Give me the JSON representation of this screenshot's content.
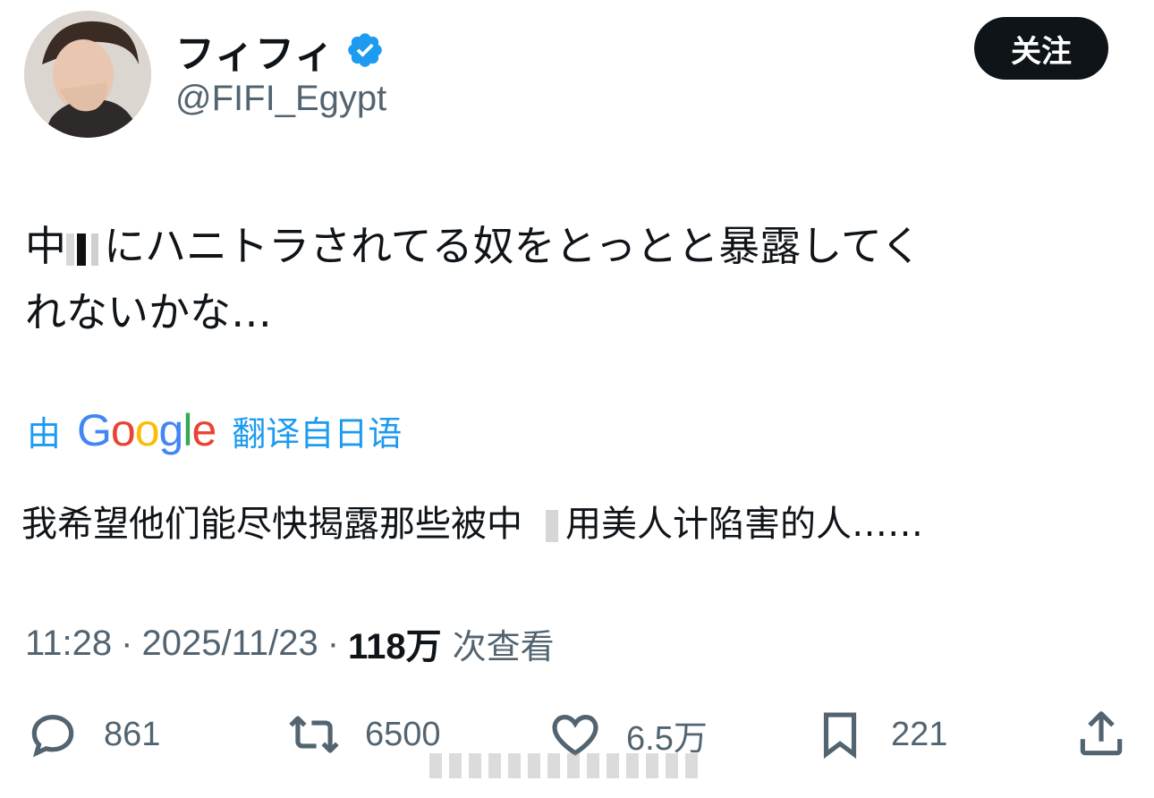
{
  "user": {
    "display_name": "フィフィ",
    "handle": "@FIFI_Egypt",
    "verified": true
  },
  "follow_button": {
    "label": "关注"
  },
  "tweet": {
    "text_part1": "中",
    "text_part2": "にハニトラされてる奴をとっとと暴露してく",
    "text_part3": "れないかな…"
  },
  "translation": {
    "prefix": "由",
    "brand": "Google",
    "suffix": "翻译自日语",
    "text_part1": "我希望他们能尽快揭露那些被中",
    "text_part2": "用美人计陷害的人……"
  },
  "meta": {
    "time": "11:28",
    "date": "2025/11/23",
    "views": "118万",
    "views_label": "次查看"
  },
  "actions": {
    "reply_count": "861",
    "retweet_count": "6500",
    "like_count": "6.5万",
    "bookmark_count": "221"
  },
  "colors": {
    "accent": "#1d9bf0",
    "text": "#0f1419",
    "secondary": "#536471"
  },
  "icons": [
    "verified-badge-icon",
    "reply-icon",
    "retweet-icon",
    "like-icon",
    "bookmark-icon",
    "share-icon"
  ]
}
